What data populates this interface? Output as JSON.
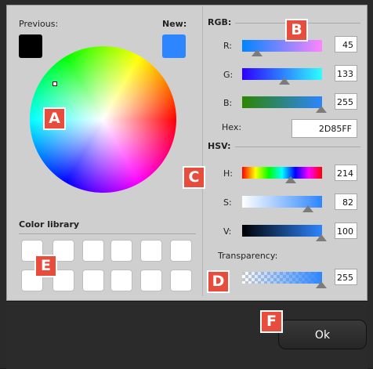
{
  "previous": {
    "label": "Previous:",
    "color": "#000000"
  },
  "new": {
    "label": "New:",
    "color": "#2D85FF"
  },
  "rgb": {
    "title": "RGB:",
    "r": {
      "label": "R:",
      "value": "45"
    },
    "g": {
      "label": "G:",
      "value": "133"
    },
    "b": {
      "label": "B:",
      "value": "255"
    },
    "hex_label": "Hex:",
    "hex_value": "2D85FF"
  },
  "hsv": {
    "title": "HSV:",
    "h": {
      "label": "H:",
      "value": "214"
    },
    "s": {
      "label": "S:",
      "value": "82"
    },
    "v": {
      "label": "V:",
      "value": "100"
    }
  },
  "transparency": {
    "label": "Transparency:",
    "value": "255"
  },
  "library": {
    "title": "Color library"
  },
  "ok_label": "Ok",
  "callouts": {
    "a": "A",
    "b": "B",
    "c": "C",
    "d": "D",
    "e": "E",
    "f": "F"
  }
}
